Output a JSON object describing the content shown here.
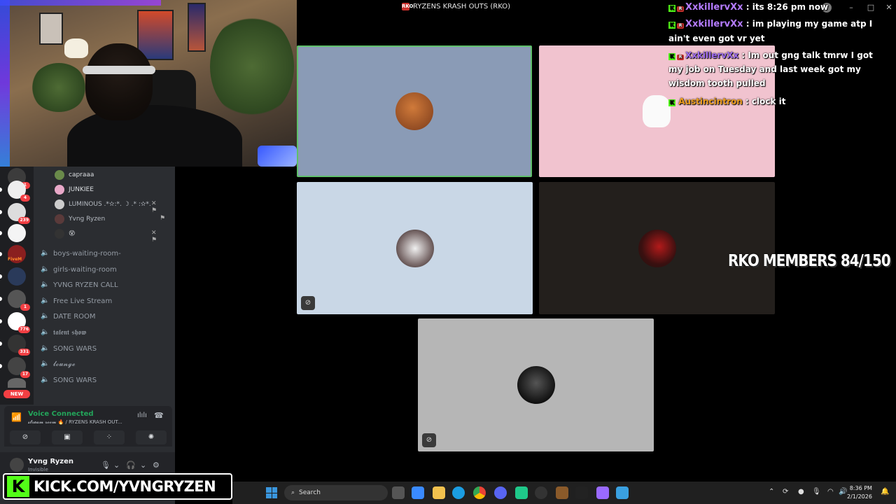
{
  "window": {
    "title": "RYZENS KRASH OUTS (RKO)",
    "logo_text": "RKO"
  },
  "voice_users": [
    {
      "name": "capraaa",
      "tail": ""
    },
    {
      "name": "JUNKIEE",
      "tail": ""
    },
    {
      "name": "LUMINOUS .*✫:*. ☽ .* :✫*.",
      "tail": "✕ ⚑"
    },
    {
      "name": "Yvng Ryzen",
      "tail": "⚑"
    },
    {
      "name": "😵",
      "tail": "✕ ⚑"
    }
  ],
  "channels": [
    {
      "name": "boys-waiting-room-",
      "style": "normal"
    },
    {
      "name": "girls-waiting-room",
      "style": "normal"
    },
    {
      "name": "YVNG RYZEN CALL",
      "style": "normal"
    },
    {
      "name": "Free Live Stream",
      "style": "normal"
    },
    {
      "name": "DATE ROOM",
      "style": "normal"
    },
    {
      "name": "𝖙𝖆𝖑𝖊𝖓𝖙 𝖘𝖍𝖔𝖜",
      "style": "script"
    },
    {
      "name": "SONG WARS",
      "style": "normal"
    },
    {
      "name": "𝓵𝓸𝓾𝓷𝓰𝓮",
      "style": "script"
    },
    {
      "name": "SONG WARS",
      "style": "normal"
    }
  ],
  "server_badges": [
    "1",
    "4",
    "239",
    "",
    "",
    "FiveM",
    "",
    "1",
    "776",
    "331",
    "17"
  ],
  "new_badge": "NEW",
  "voice_panel": {
    "status": "Voice Connected",
    "sub": "𝓼𝓽𝓻𝓮𝓪𝓶 𝓻𝓸𝓸𝓶 🔥 / RYZENS KRASH OUT...",
    "actions": [
      "camera-off",
      "screen-share",
      "activities",
      "soundboard"
    ]
  },
  "user_bar": {
    "name": "Yvng Ryzen",
    "status": "Invisible"
  },
  "kick": {
    "logo": "K",
    "url": "KICK.COM/YVNGRYZEN"
  },
  "tiles": [
    {
      "bg": "#8a9bb6",
      "avatar": "monkey-avatar",
      "muted": false,
      "speaking": true
    },
    {
      "bg": "#f1c3cf",
      "avatar": "cat-avatar",
      "muted": false,
      "speaking": false
    },
    {
      "bg": "#c9d7e6",
      "avatar": "anime-avatar",
      "muted": true,
      "speaking": false
    },
    {
      "bg": "#231f1c",
      "avatar": "red-char-avatar",
      "muted": false,
      "speaking": false
    },
    {
      "bg": "#b6b6b6",
      "avatar": "dark-avatar",
      "muted": true,
      "speaking": false
    }
  ],
  "chat": [
    {
      "user": "XxkillervXx",
      "color": "#b57cff",
      "text": " : its 8:26 pm now"
    },
    {
      "user": "XxkillervXx",
      "color": "#b57cff",
      "text": " : im playing my game atp I ain't even got vr yet"
    },
    {
      "user": "XxkillervXx",
      "color": "#b57cff",
      "text": " : Im out gng talk tmrw I got my job on Tuesday and last week got my wisdom tooth pulled"
    },
    {
      "user": "Austincintron",
      "color": "#f0a020",
      "text": " : clock it"
    }
  ],
  "overlay": {
    "members": "RKO MEMBERS 84/150"
  },
  "taskbar": {
    "search": "Search",
    "time": "8:36 PM",
    "date": "2/1/2026"
  },
  "colors": {
    "kick_green": "#53fc18",
    "discord_bg": "#2b2d31",
    "voice_green": "#23a55a"
  }
}
